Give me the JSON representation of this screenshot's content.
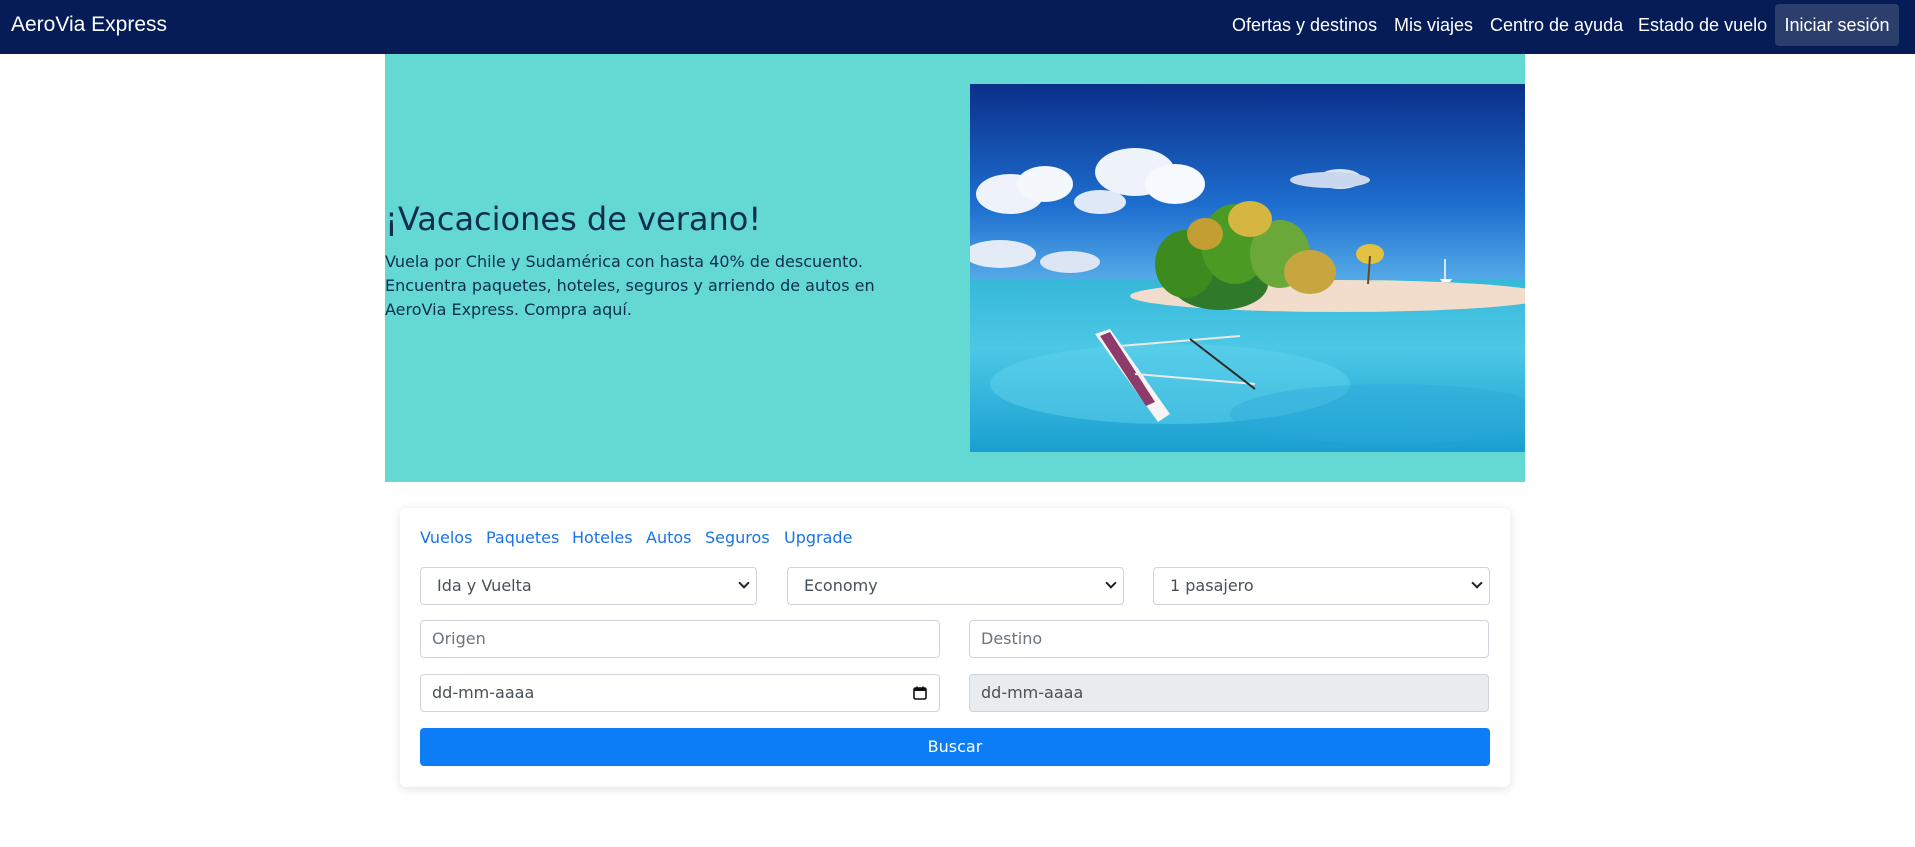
{
  "navbar": {
    "brand": "AeroVia Express",
    "links": [
      "Ofertas y destinos",
      "Mis viajes",
      "Centro de ayuda",
      "Estado de vuelo"
    ],
    "login_label": "Iniciar sesión",
    "background_color": "#051c56"
  },
  "hero": {
    "title": "¡Vacaciones de verano!",
    "text": "Vuela por Chile y Sudamérica con hasta 40% de descuento. Encuentra paquetes, hoteles, seguros y arriendo de autos en AeroVia Express. Compra aquí.",
    "background_color": "#64d9d3"
  },
  "search": {
    "tabs": [
      "Vuelos",
      "Paquetes",
      "Hoteles",
      "Autos",
      "Seguros",
      "Upgrade"
    ],
    "trip_type": "Ida y Vuelta",
    "cabin_class": "Economy",
    "passengers": "1 pasajero",
    "origin_placeholder": "Origen",
    "destination_placeholder": "Destino",
    "departure_date_placeholder": "dd-mm-aaaa",
    "return_date_placeholder": "dd-mm-aaaa",
    "search_label": "Buscar",
    "accent_color": "#0d7cf7"
  }
}
